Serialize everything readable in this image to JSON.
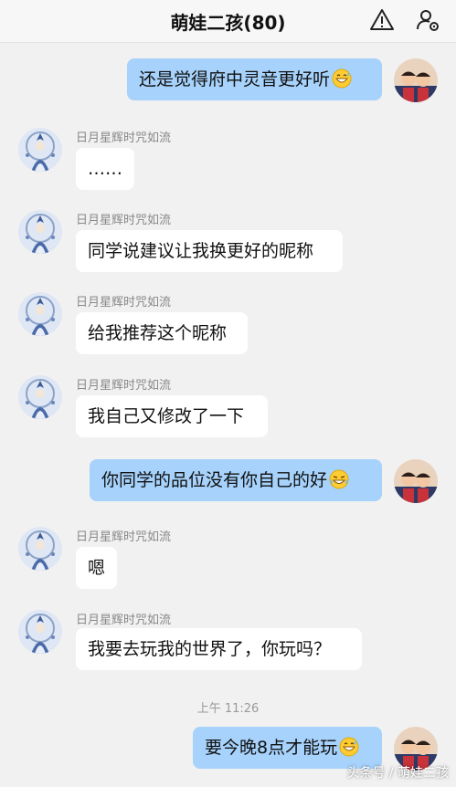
{
  "header": {
    "title": "萌娃二孩(80)",
    "alert_icon": "warning-triangle-icon",
    "member_icon": "group-settings-icon"
  },
  "sender_name": "日月星辉时咒如流",
  "messages": [
    {
      "side": "out",
      "text": "还是觉得府中灵音更好听",
      "emoji": "grin-sweat-emoji"
    },
    {
      "side": "in",
      "sender": "日月星辉时咒如流",
      "text": "……"
    },
    {
      "side": "in",
      "sender": "日月星辉时咒如流",
      "text": "同学说建议让我换更好的昵称"
    },
    {
      "side": "in",
      "sender": "日月星辉时咒如流",
      "text": "给我推荐这个昵称"
    },
    {
      "side": "in",
      "sender": "日月星辉时咒如流",
      "text": "我自己又修改了一下"
    },
    {
      "side": "out",
      "text": "你同学的品位没有你自己的好",
      "emoji": "tear-laugh-emoji"
    },
    {
      "side": "in",
      "sender": "日月星辉时咒如流",
      "text": "嗯"
    },
    {
      "side": "in",
      "sender": "日月星辉时咒如流",
      "text": "我要去玩我的世界了，你玩吗？"
    },
    {
      "side": "out",
      "text": "要今晚8点才能玩",
      "emoji": "grin-sweat-emoji"
    }
  ],
  "timestamp": "上午 11:26",
  "watermark": "头条号 / 萌娃二孩",
  "colors": {
    "background": "#f1f1f1",
    "outgoing_bubble": "#a6d2fb",
    "incoming_bubble": "#ffffff",
    "sender_text": "#888888"
  }
}
